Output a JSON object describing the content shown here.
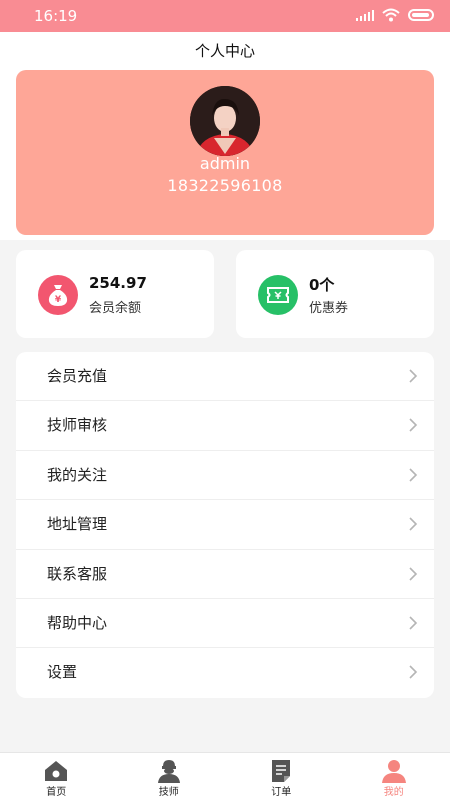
{
  "status_bar": {
    "time": "16:19"
  },
  "header": {
    "title": "个人中心"
  },
  "profile": {
    "username": "admin",
    "phone": "18322596108"
  },
  "stats": [
    {
      "value": "254.97",
      "label": "会员余额",
      "icon": "money-bag-icon",
      "color": "#f2566f"
    },
    {
      "value": "0个",
      "label": "优惠券",
      "icon": "coupon-icon",
      "color": "#27c067"
    }
  ],
  "menu": [
    {
      "label": "会员充值"
    },
    {
      "label": "技师审核"
    },
    {
      "label": "我的关注"
    },
    {
      "label": "地址管理"
    },
    {
      "label": "联系客服"
    },
    {
      "label": "帮助中心"
    },
    {
      "label": "设置"
    }
  ],
  "tabbar": {
    "items": [
      {
        "label": "首页",
        "icon": "home-icon"
      },
      {
        "label": "技师",
        "icon": "technician-icon"
      },
      {
        "label": "订单",
        "icon": "order-icon"
      },
      {
        "label": "我的",
        "icon": "profile-icon",
        "active": true
      }
    ]
  },
  "colors": {
    "accent": "#f98c93",
    "card": "#fea697",
    "active_tab": "#f5857f"
  }
}
